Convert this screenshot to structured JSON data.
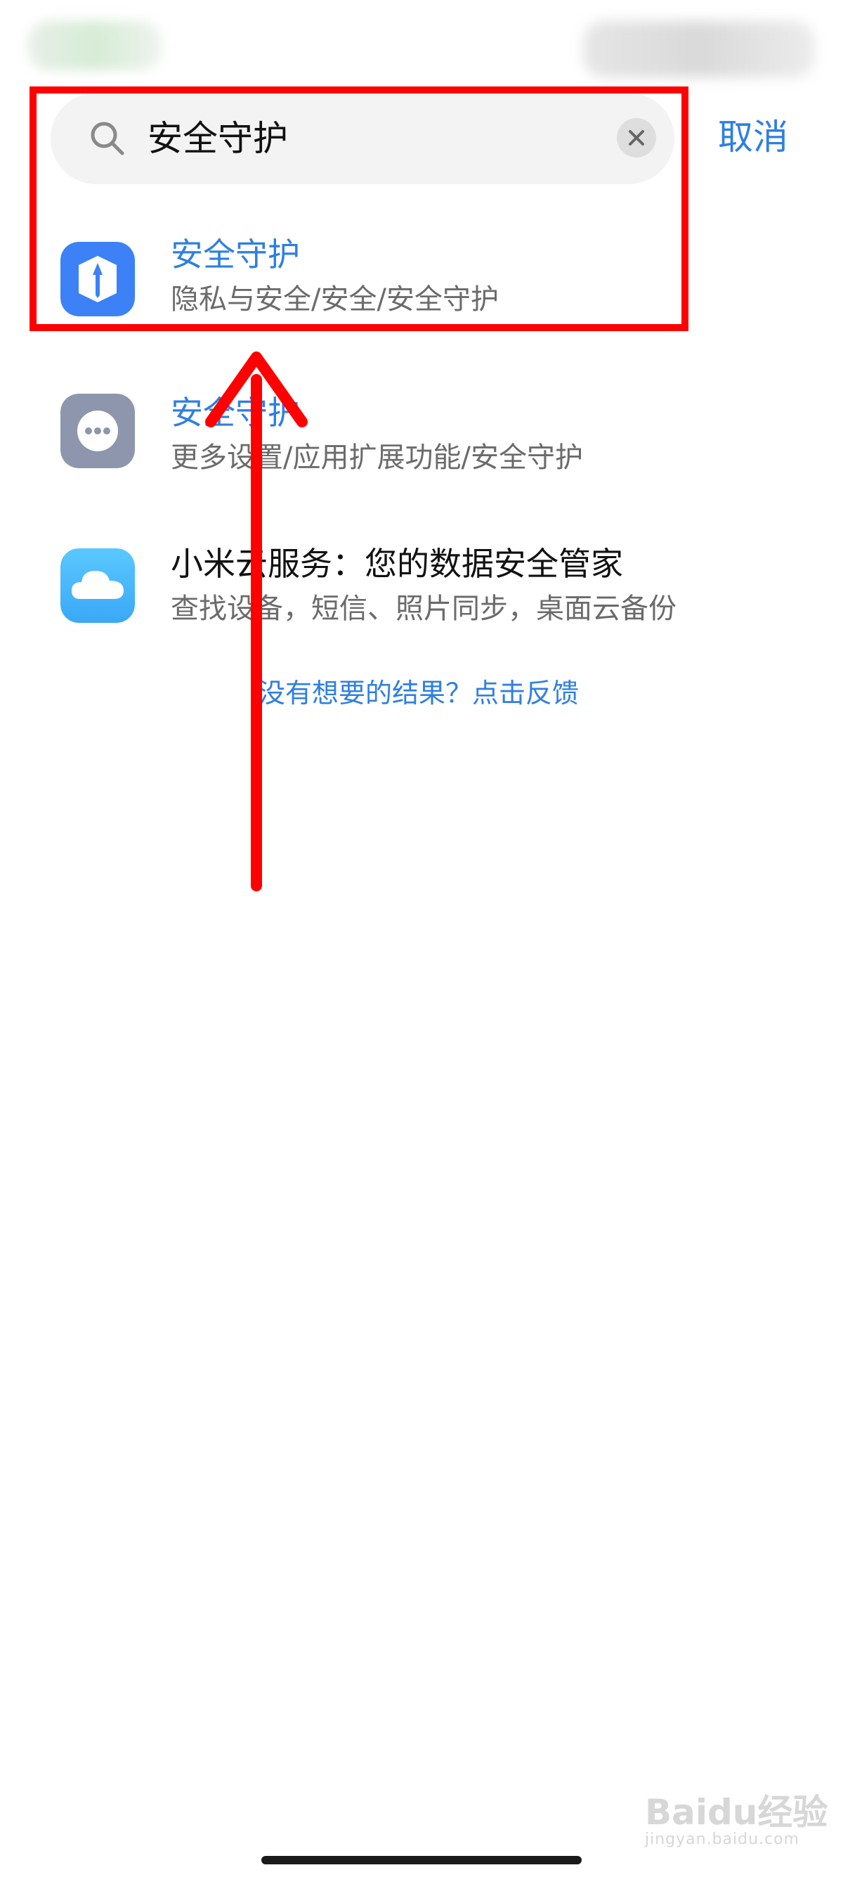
{
  "search": {
    "query": "安全守护",
    "cancel_label": "取消"
  },
  "results": [
    {
      "title": "安全守护",
      "subtitle": "隐私与安全/安全/安全守护",
      "icon": "shield-app-icon"
    },
    {
      "title": "安全守护",
      "subtitle": "更多设置/应用扩展功能/安全守护",
      "icon": "more-settings-icon"
    },
    {
      "title": "小米云服务：您的数据安全管家",
      "subtitle": "查找设备，短信、照片同步，桌面云备份",
      "icon": "cloud-icon"
    }
  ],
  "feedback_link": "没有想要的结果？点击反馈",
  "watermark": {
    "logo": "Baidu经验",
    "url": "jingyan.baidu.com"
  },
  "colors": {
    "accent": "#2f7fe0",
    "annotation": "#ff0000"
  }
}
